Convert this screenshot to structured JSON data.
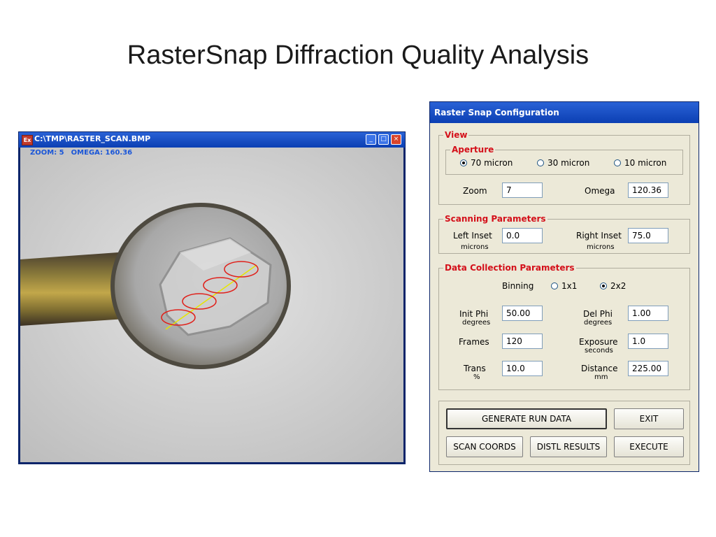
{
  "slide": {
    "title": "RasterSnap Diffraction Quality Analysis"
  },
  "image_window": {
    "title": "C:\\TMP\\RASTER_SCAN.BMP",
    "app_icon": "Ex",
    "overlay": {
      "zoom": "ZOOM: 5",
      "omega": "OMEGA: 160.36"
    },
    "buttons": {
      "minimize": "_",
      "maximize": "□",
      "close": "×"
    }
  },
  "config": {
    "title": "Raster Snap Configuration",
    "view": {
      "label": "View",
      "aperture": {
        "label": "Aperture",
        "options": [
          "70 micron",
          "30 micron",
          "10 micron"
        ],
        "selected": "70 micron"
      },
      "zoom": {
        "label": "Zoom",
        "value": "7"
      },
      "omega": {
        "label": "Omega",
        "value": "120.36"
      }
    },
    "scanning": {
      "label": "Scanning Parameters",
      "left_inset": {
        "label": "Left Inset",
        "unit": "microns",
        "value": "0.0"
      },
      "right_inset": {
        "label": "Right Inset",
        "unit": "microns",
        "value": "75.0"
      }
    },
    "data_collection": {
      "label": "Data Collection Parameters",
      "binning": {
        "label": "Binning",
        "options": [
          "1x1",
          "2x2"
        ],
        "selected": "2x2"
      },
      "init_phi": {
        "label": "Init Phi",
        "unit": "degrees",
        "value": "50.00"
      },
      "del_phi": {
        "label": "Del Phi",
        "unit": "degrees",
        "value": "1.00"
      },
      "frames": {
        "label": "Frames",
        "value": "120"
      },
      "exposure": {
        "label": "Exposure",
        "unit": "seconds",
        "value": "1.0"
      },
      "trans": {
        "label": "Trans",
        "unit": "%",
        "value": "10.0"
      },
      "distance": {
        "label": "Distance",
        "unit": "mm",
        "value": "225.00"
      }
    },
    "buttons": {
      "generate": "GENERATE RUN DATA",
      "exit": "EXIT",
      "scan_coords": "SCAN COORDS",
      "distl_results": "DISTL RESULTS",
      "execute": "EXECUTE"
    }
  },
  "colors": {
    "group_label": "#d4101a",
    "titlebar": "#0b3fb3",
    "dialog_bg": "#ece9d8"
  }
}
